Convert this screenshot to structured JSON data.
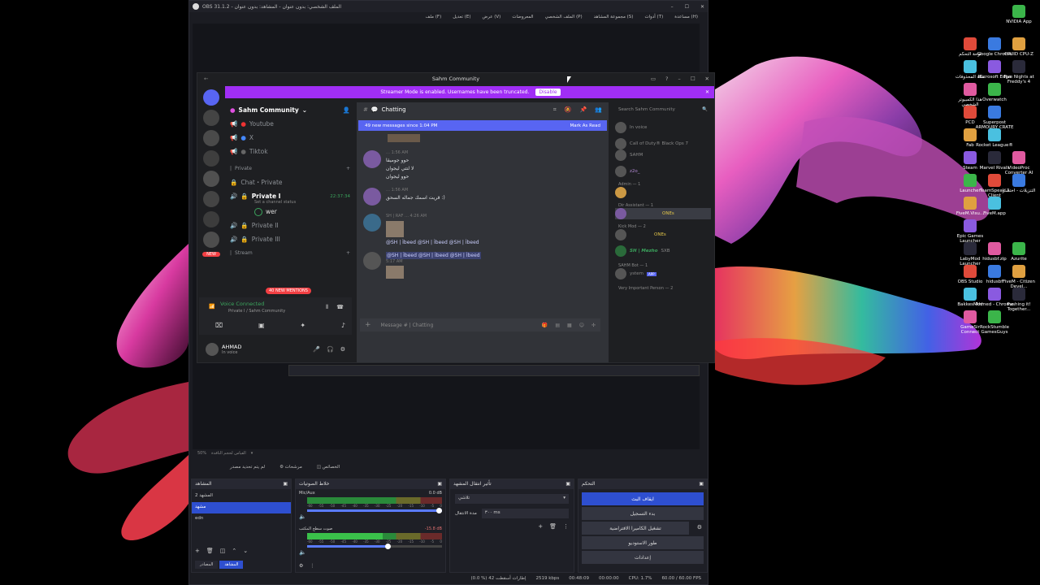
{
  "obs": {
    "title": "OBS 31.1.2 - الملف الشخصي: بدون عنوان - المشاهد: بدون عنوان",
    "menu": [
      "(F) ملف",
      "(E) تعديل",
      "(V) عرض",
      "المعروضات",
      "(P) الملف الشخصي",
      "(S) مجموعة المشاهد",
      "(T) أدوات",
      "(H) مساعدة"
    ],
    "preview_zoom": "50%",
    "preview_mode": "القياس لحجم النافذة",
    "source_hint": "لم يتم تحديد مصدر",
    "filters": "مرشحات",
    "properties": "الخصائص"
  },
  "docks": {
    "scenes": {
      "title": "المشاهد",
      "items": [
        "المشهد 2",
        "مشهد",
        "edn"
      ],
      "selected": 1
    },
    "sources_tab": "المصادر",
    "scenes_tab": "المشاهد",
    "mixer": {
      "title": "خلاط الصوتيات",
      "ch1": {
        "name": "Mic/Aux",
        "db": "0.0 dB"
      },
      "ch2": {
        "name": "صوت سطح المكتب",
        "db": "-15.8 dB"
      },
      "ticks": [
        "-60",
        "-55",
        "-50",
        "-45",
        "-40",
        "-35",
        "-30",
        "-25",
        "-20",
        "-15",
        "-10",
        "-5",
        "0"
      ]
    },
    "transitions": {
      "title": "تأثير انتقال المشهد",
      "type": "تلاشي",
      "duration_label": "مدة الانتقال",
      "duration": "٣٠٠ ms"
    },
    "controls": {
      "title": "التحكم",
      "buttons": [
        "ايقاف البث",
        "بدء التسجيل",
        "تشغيل الكاميرا الافتراضية",
        "طور الاستوديو",
        "إعدادات"
      ]
    }
  },
  "status": {
    "drop": "(0.0 %) 42 إطارات أسقطت",
    "kbps": "2519 kbps",
    "stream_time": "00:48:09",
    "rec_time": "00:00:00",
    "cpu": "CPU: 1.7%",
    "fps": "60.00 / 60.00 FPS"
  },
  "discord": {
    "title": "Sahm Community",
    "banner": "Streamer Mode is enabled. Usernames have been truncated.",
    "banner_btn": "Disable",
    "server": "Sahm Community",
    "channels": [
      "Youtube",
      "X",
      "Tiktok"
    ],
    "cat_private": "Private",
    "ch_chat_private": "Chat・Private",
    "ch_private1": "Private I",
    "timer": "22:37:34",
    "status_hint": "Set a channel status",
    "voice_user": "wer",
    "ch_private2": "Private II",
    "ch_private3": "Private III",
    "cat_stream": "Stream",
    "mentions": "40 NEW MENTIONS",
    "new_badge": "NEW",
    "vc_title": "Voice Connected",
    "vc_sub": "Private I / Sahm Community",
    "user": "AHMAD",
    "user_status": "In voice",
    "chat_name": "Chatting",
    "new_msgs": "49 new messages since 1:04 PM",
    "mark_read": "Mark As Read",
    "search": "Search Sahm Community",
    "input": "Message #  | Chatting",
    "msgs": [
      {
        "time": "1:56 AM",
        "lines": [
          "حوو جوميقا",
          "لا لتتي ليجوان",
          "حوو ليجوان"
        ]
      },
      {
        "time": "1:56 AM",
        "lines": [
          "قريت اسمك جماله السحق :)"
        ]
      },
      {
        "time": "4:26 AM",
        "lines": [
          "@SH | Ìbeed  @SH | Ìbeed  @SH | Ìbeed"
        ]
      },
      {
        "time": "5:17 AM",
        "lines": [
          "@SH | Ìbeed  @SH | Ìbeed  @SH | Ìbeed"
        ]
      }
    ],
    "members": {
      "invoice": "In voice",
      "cod": "Call of Duty® Black Ops 7",
      "admin": "Admin — 1",
      "dir": "Dir Assistant — 1",
      "kick": "Kick Mod — 2",
      "mezho": "SH | Mezho",
      "sahm_bot": "SAHM Bot — 1",
      "vip": "Very Important Person — 2",
      "app": "APP"
    }
  },
  "desktop": [
    [
      "NVIDIA App"
    ],
    [
      "لوحة التحكم",
      "Google Chrome",
      "CPUID CPU-Z"
    ],
    [
      "سلة المحذوفات",
      "Microsoft Edge",
      "Five Nights at Freddy's 4"
    ],
    [
      "هذا الكمبيوتر الشخصي",
      "Overwatch"
    ],
    [
      "PCD",
      "Superpost ARMOURY CRATE"
    ],
    [
      "Fab",
      "Rocket League®"
    ],
    [
      "Steam",
      "Marvel Rivals",
      "VideoProc Converter AI"
    ],
    [
      "Launcher",
      "TeamSpeak 3 Client",
      "التنزيلات - اختصار"
    ],
    [
      "FiveM.Visu...",
      "FiveM.app"
    ],
    [
      "Epic Games Launcher"
    ],
    [
      "LabyMod Launcher",
      "hidusbf.zip",
      "Azurite"
    ],
    [
      "OBS Studio",
      "hidusbf",
      "FiveM - Citizen Devel..."
    ],
    [
      "BakkesMod",
      "Ahmed - Chrome",
      "Pushing it! Together..."
    ],
    [
      "GameSir Connect",
      "RockStumble GamesGuys"
    ]
  ]
}
